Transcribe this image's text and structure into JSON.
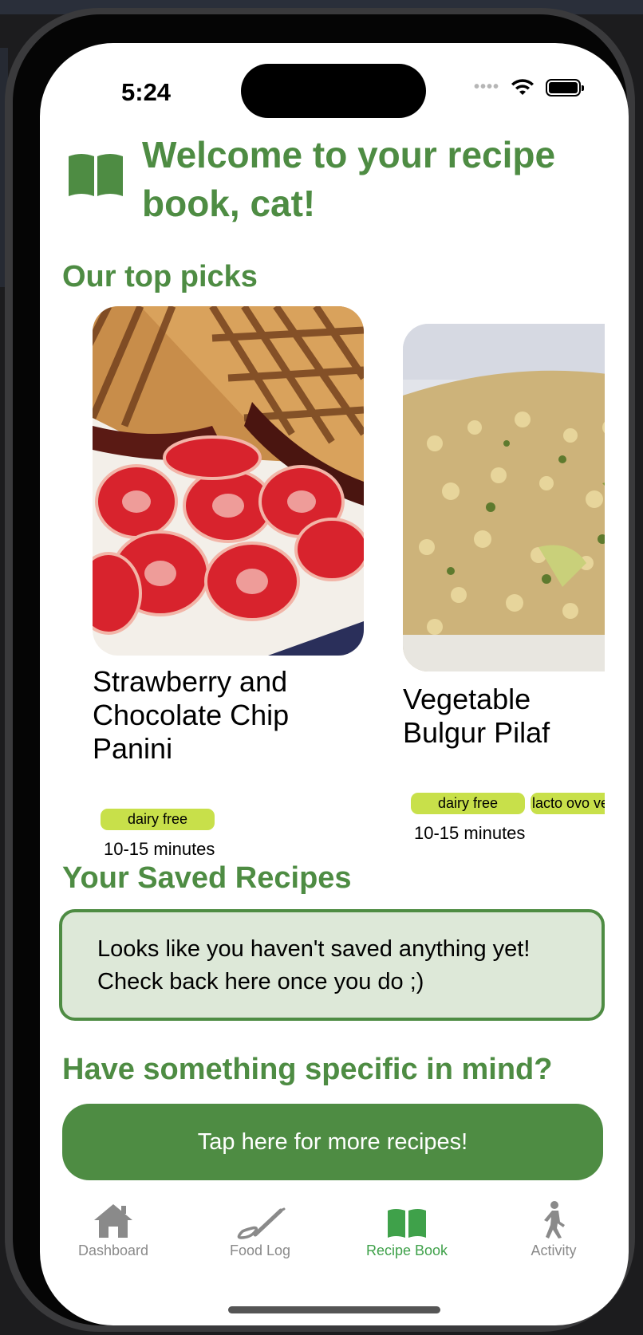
{
  "status_bar": {
    "time": "5:24"
  },
  "header": {
    "title": "Welcome to your recipe book, cat!"
  },
  "top_picks": {
    "title": "Our top picks",
    "recipes": [
      {
        "name": "Strawberry and Chocolate Chip Panini",
        "tags": [
          "dairy free"
        ],
        "time": "10-15 minutes"
      },
      {
        "name": "Vegetable Bulgur Pilaf",
        "tags": [
          "dairy free",
          "lacto ovo vegetarian"
        ],
        "time": "10-15 minutes"
      }
    ]
  },
  "saved": {
    "title": "Your Saved Recipes",
    "empty_line1": "Looks like you haven't saved anything yet!",
    "empty_line2": "Check back here once you do ;)"
  },
  "specific": {
    "title": "Have something specific in mind?",
    "button_label": "Tap here for more recipes!"
  },
  "tab_bar": {
    "items": [
      {
        "label": "Dashboard",
        "icon": "house-icon",
        "active": false
      },
      {
        "label": "Food Log",
        "icon": "pencil-icon",
        "active": false
      },
      {
        "label": "Recipe Book",
        "icon": "book-icon",
        "active": true
      },
      {
        "label": "Activity",
        "icon": "walking-figure-icon",
        "active": false
      }
    ]
  },
  "colors": {
    "accent_green": "#4e8c43",
    "tag_yellow_green": "#c8e04a",
    "saved_box_bg": "#dde8d8",
    "active_tab": "#3fa14a",
    "inactive_tab": "#8a8a8a"
  }
}
